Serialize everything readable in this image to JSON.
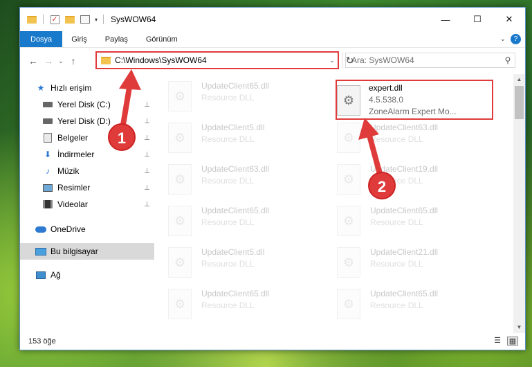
{
  "window": {
    "title": "SysWOW64",
    "qat_separator": "|",
    "controls": {
      "minimize": "—",
      "maximize": "☐",
      "close": "✕"
    }
  },
  "ribbon": {
    "tabs": [
      "Dosya",
      "Giriş",
      "Paylaş",
      "Görünüm"
    ],
    "expand": "⌄",
    "help": "?"
  },
  "navigation": {
    "back": "←",
    "forward": "→",
    "recent": "⌄",
    "up": "↑",
    "address": "C:\\Windows\\SysWOW64",
    "address_dropdown": "⌄",
    "refresh": "↻",
    "search_placeholder": "Ara: SysWOW64",
    "search_icon": "⚲"
  },
  "sidebar": {
    "quick_access": "Hızlı erişim",
    "items": [
      {
        "label": "Yerel Disk (C:)",
        "icon": "disk-icon",
        "pinned": true
      },
      {
        "label": "Yerel Disk (D:)",
        "icon": "disk-icon",
        "pinned": true
      },
      {
        "label": "Belgeler",
        "icon": "documents-icon",
        "pinned": true
      },
      {
        "label": "İndirmeler",
        "icon": "download-icon",
        "pinned": true
      },
      {
        "label": "Müzik",
        "icon": "music-icon",
        "pinned": true
      },
      {
        "label": "Resimler",
        "icon": "pictures-icon",
        "pinned": true
      },
      {
        "label": "Videolar",
        "icon": "videos-icon",
        "pinned": true
      }
    ],
    "onedrive": "OneDrive",
    "this_pc": "Bu bilgisayar",
    "network": "Ağ",
    "pin_glyph": "📌"
  },
  "files": {
    "left_column": [
      {
        "name": "UpdateClient65.dll",
        "type": "Resource DLL"
      },
      {
        "name": "UpdateClient5.dll",
        "type": "Resource DLL"
      },
      {
        "name": "UpdateClient63.dll",
        "type": "Resource DLL"
      },
      {
        "name": "UpdateClient65.dll",
        "type": "Resource DLL"
      },
      {
        "name": "UpdateClient5.dll",
        "type": "Resource DLL"
      },
      {
        "name": "UpdateClient65.dll",
        "type": "Resource DLL"
      }
    ],
    "highlighted": {
      "name": "expert.dll",
      "version": "4.5.538.0",
      "description": "ZoneAlarm Expert Mo..."
    },
    "right_column": [
      {
        "name": "UpdateClient63.dll",
        "type": "Resource DLL"
      },
      {
        "name": "UpdateClient19.dll",
        "type": "Resource DLL"
      },
      {
        "name": "UpdateClient65.dll",
        "type": "Resource DLL"
      },
      {
        "name": "UpdateClient21.dll",
        "type": "Resource DLL"
      },
      {
        "name": "UpdateClient65.dll",
        "type": "Resource DLL"
      }
    ],
    "file_glyph": "⚙"
  },
  "status": {
    "count": "153 öğe"
  },
  "annotations": {
    "step1": "1",
    "step2": "2",
    "color": "#e03b3b"
  }
}
